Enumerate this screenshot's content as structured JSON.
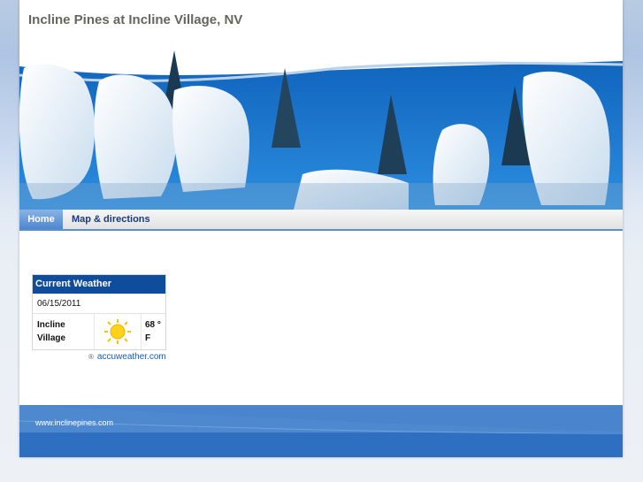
{
  "site": {
    "title": "Incline Pines at Incline Village, NV"
  },
  "nav": {
    "home": "Home",
    "map": "Map & directions"
  },
  "weather": {
    "header": "Current Weather",
    "date": "06/15/2011",
    "city": "Incline Village",
    "temp": "68 ° F",
    "icon": "sun-icon",
    "provider": "accuweather.com"
  },
  "footer": {
    "url": "www.inclinepines.com"
  },
  "colors": {
    "accent": "#0f4c9c",
    "nav_active": "#5b8fc8",
    "title": "#666660",
    "link": "#1a5bb5"
  }
}
